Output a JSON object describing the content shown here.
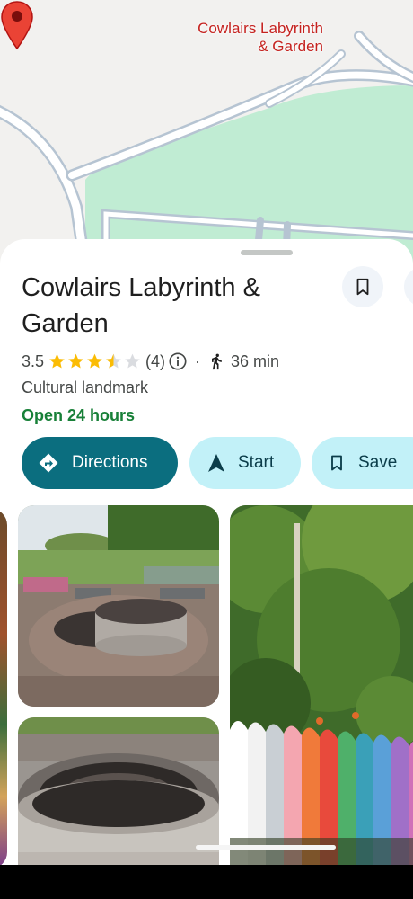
{
  "map": {
    "place_label": "Cowlairs Labyrinth\n& Garden",
    "colors": {
      "park": "#c0ecd3",
      "road_edge": "#b6c4d2",
      "road_fill": "#ffffff",
      "pin": "#ea4335"
    }
  },
  "place": {
    "name": "Cowlairs Labyrinth & Garden",
    "rating": "3.5",
    "stars": 3.5,
    "review_count": "(4)",
    "separator": "·",
    "walk_time": "36 min",
    "category": "Cultural landmark",
    "hours_status": "Open 24 hours"
  },
  "actions": {
    "directions": "Directions",
    "start": "Start",
    "save": "Save"
  },
  "icons": {
    "save_place": "bookmark-icon",
    "share": "share-icon",
    "info": "info-icon",
    "walk": "walking-icon",
    "directions": "directions-diamond-icon",
    "start": "navigation-arrow-icon",
    "save": "bookmark-icon"
  },
  "photos": [
    {
      "description_name": "photo-colorful-bench-partial"
    },
    {
      "description_name": "photo-brick-labyrinth-firepit"
    },
    {
      "description_name": "photo-burnt-firepit-closeup"
    },
    {
      "description_name": "photo-rainbow-bench-trees"
    }
  ],
  "colors": {
    "accent": "#0b6e7f",
    "chip_light": "#c2f1f8",
    "open_green": "#188038",
    "star": "#fbbc04"
  }
}
